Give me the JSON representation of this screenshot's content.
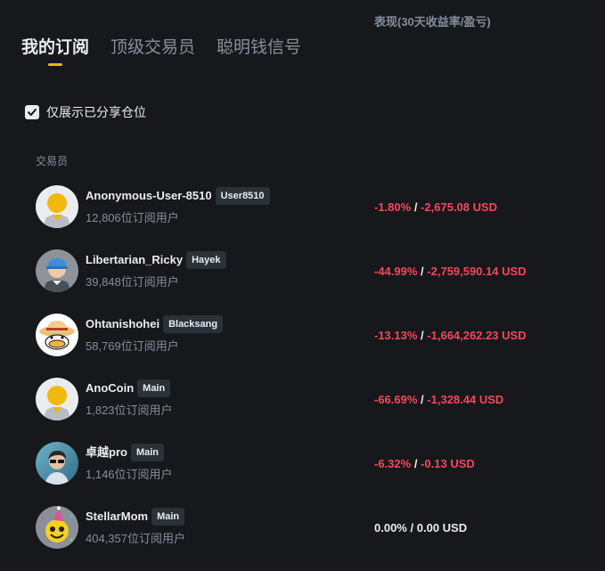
{
  "tabs": [
    {
      "label": "我的订阅",
      "active": true
    },
    {
      "label": "顶级交易员",
      "active": false
    },
    {
      "label": "聪明钱信号",
      "active": false
    }
  ],
  "filter": {
    "label": "仅展示已分享仓位",
    "checked": true
  },
  "headers": {
    "trader": "交易员",
    "performance": "表现(30天收益率/盈亏)"
  },
  "traders": [
    {
      "name": "Anonymous-User-8510",
      "badge": "User8510",
      "subscribers": "12,806位订阅用户",
      "pct": "-1.80%",
      "pnl": "-2,675.08 USD",
      "negative": true,
      "avatar": "yellow-face-icon"
    },
    {
      "name": "Libertarian_Ricky",
      "badge": "Hayek",
      "subscribers": "39,848位订阅用户",
      "pct": "-44.99%",
      "pnl": "-2,759,590.14 USD",
      "negative": true,
      "avatar": "blue-cap-face-icon"
    },
    {
      "name": "Ohtanishohei",
      "badge": "Blacksang",
      "subscribers": "58,769位订阅用户",
      "pct": "-13.13%",
      "pnl": "-1,664,262.23 USD",
      "negative": true,
      "avatar": "straw-hat-duck-icon"
    },
    {
      "name": "AnoCoin",
      "badge": "Main",
      "subscribers": "1,823位订阅用户",
      "pct": "-66.69%",
      "pnl": "-1,328.44 USD",
      "negative": true,
      "avatar": "yellow-face-icon"
    },
    {
      "name": "卓越pro",
      "badge": "Main",
      "subscribers": "1,146位订阅用户",
      "pct": "-6.32%",
      "pnl": "-0.13 USD",
      "negative": true,
      "avatar": "photo-portrait-icon"
    },
    {
      "name": "StellarMom",
      "badge": "Main",
      "subscribers": "404,357位订阅用户",
      "pct": "0.00%",
      "pnl": "0.00 USD",
      "negative": false,
      "avatar": "party-smiley-icon"
    }
  ],
  "colors": {
    "accent": "#f0b90b",
    "negative": "#f6465d",
    "background": "#17181c"
  }
}
